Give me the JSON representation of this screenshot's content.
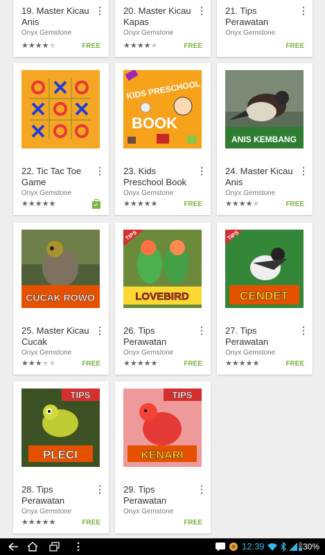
{
  "apps": [
    {
      "title": "19. Master Kicau Anis",
      "developer": "Onyx Gemstone",
      "rating": 4.5,
      "price": "FREE",
      "thumb": "none"
    },
    {
      "title": "20. Master Kicau Kapas",
      "developer": "Onyx Gemstone",
      "rating": 4.5,
      "price": "FREE",
      "thumb": "none"
    },
    {
      "title": "21. Tips Perawatan",
      "developer": "Onyx Gemstone",
      "rating": null,
      "price": "FREE",
      "thumb": "none"
    },
    {
      "title": "22. Tic Tac Toe Game",
      "developer": "Onyx Gemstone",
      "rating": 5,
      "price": "",
      "installed": true,
      "thumb": "tictactoe"
    },
    {
      "title": "23. Kids Preschool Book",
      "developer": "Onyx Gemstone",
      "rating": 5,
      "price": "FREE",
      "thumb": "kids",
      "thumb_text": [
        "KIDS PRESCHOOL",
        "BOOK"
      ]
    },
    {
      "title": "24. Master Kicau Anis",
      "developer": "Onyx Gemstone",
      "rating": 4.5,
      "price": "FREE",
      "thumb": "bird",
      "thumb_text": [
        "ANIS KEMBANG"
      ]
    },
    {
      "title": "25. Master Kicau Cucak",
      "developer": "Onyx Gemstone",
      "rating": 3.5,
      "price": "FREE",
      "thumb": "bird",
      "thumb_text": [
        "CUCAK ROWO"
      ]
    },
    {
      "title": "26. Tips Perawatan",
      "developer": "Onyx Gemstone",
      "rating": 5,
      "price": "FREE",
      "thumb": "bird",
      "thumb_text": [
        "TIPS",
        "LOVEBIRD"
      ]
    },
    {
      "title": "27. Tips Perawatan",
      "developer": "Onyx Gemstone",
      "rating": 5,
      "price": "FREE",
      "thumb": "bird",
      "thumb_text": [
        "TIPS",
        "CENDET"
      ]
    },
    {
      "title": "28. Tips Perawatan",
      "developer": "Onyx Gemstone",
      "rating": 5,
      "price": "FREE",
      "thumb": "bird",
      "thumb_text": [
        "TIPS",
        "PLECI"
      ]
    },
    {
      "title": "29. Tips Perawatan",
      "developer": "Onyx Gemstone",
      "rating": null,
      "price": "FREE",
      "thumb": "bird",
      "thumb_text": [
        "TIPS",
        "KENARI"
      ]
    }
  ],
  "status_bar": {
    "time": "12:39",
    "battery": "30%"
  },
  "nav_icons": [
    "back-icon",
    "home-icon",
    "recent-apps-icon",
    "menu-icon"
  ],
  "colors": {
    "free": "#7cb342",
    "time": "#33b5e5"
  }
}
